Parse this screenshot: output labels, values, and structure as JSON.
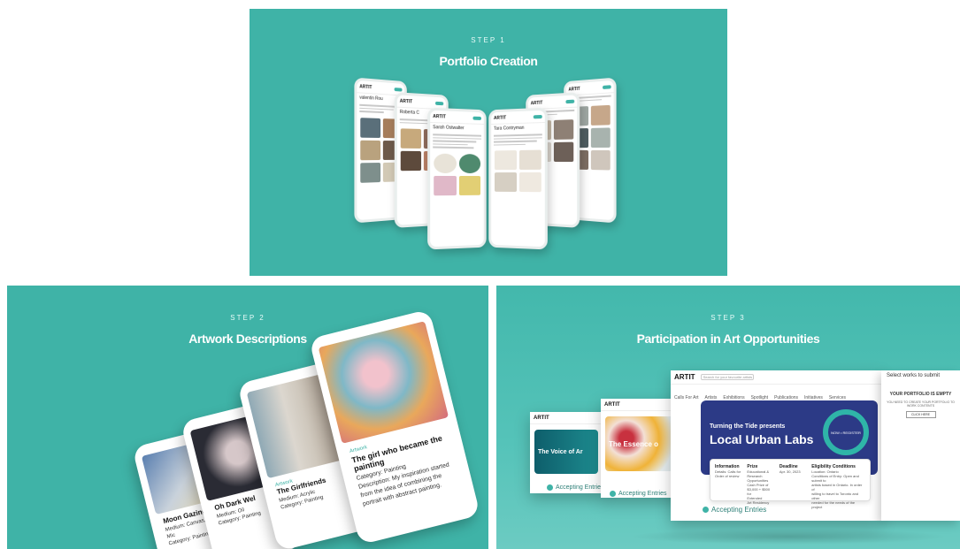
{
  "colors": {
    "accent": "#3fb3a7",
    "banner": "#2c3a86",
    "white": "#ffffff"
  },
  "step1": {
    "label": "STEP 1",
    "title": "Portfolio Creation",
    "phones": [
      {
        "brand": "ARTIT",
        "name": "valentin Rou"
      },
      {
        "brand": "ARTIT",
        "name": "Roberta C"
      },
      {
        "brand": "ARTIT",
        "name": "Sarah Ostwalter"
      },
      {
        "brand": "ARTIT",
        "name": "Tara Contryman"
      },
      {
        "brand": "ARTIT",
        "name": ""
      },
      {
        "brand": "ARTIT",
        "name": ""
      }
    ]
  },
  "step2": {
    "label": "STEP 2",
    "title": "Artwork Descriptions",
    "cards": [
      {
        "title": "Moon Gazing",
        "year": "2021",
        "medium": "Medium: Canvas, ink, Mic",
        "category": "Category: Painting"
      },
      {
        "title": "Oh Dark Wel",
        "year": "2022",
        "medium": "Medium: Oil",
        "category": "Category: Painting"
      },
      {
        "title": "The Girlfriends",
        "year": "2022",
        "medium": "Medium: Acrylic",
        "category": "Category: Painting"
      },
      {
        "title": "The girl who became the painting",
        "year": "",
        "medium": "Category: Painting",
        "category": "Description: My inspiration started from the idea of combining the portrait with abstract painting."
      }
    ]
  },
  "step3": {
    "label": "STEP 3",
    "title": "Participation in Art Opportunities",
    "win_left": {
      "brand": "ARTIT",
      "banner": "The Voice of Ar",
      "status": "Accepting Entries"
    },
    "win_mid": {
      "brand": "ARTIT",
      "banner": "The Essence o",
      "status": "Accepting Entries"
    },
    "win_main": {
      "brand": "ARTIT",
      "search_placeholder": "Search for your favourite artists",
      "nav": [
        "Calls For Art",
        "Artists",
        "Exhibitions",
        "Spotlight",
        "Publications",
        "Initiatives",
        "Services"
      ],
      "presenter": "Turning the Tide presents",
      "headline": "Local Urban Labs",
      "badge": "NOW • REGISTER",
      "info": {
        "h": "Information",
        "t": "Details: Calls for\nOrder of review"
      },
      "prize": {
        "h": "Prize",
        "t": "Educational &\nResearch\nOpportunities\nCash Prize of\n$3,000 + $500 for\nExtended\nArt Residency"
      },
      "deadline": {
        "h": "Deadline",
        "t": "Apr. 30, 2023"
      },
      "eligibility": {
        "h": "Eligibility Conditions",
        "t": "Location: Ontario\nConditions of Entry: Open and submit to\nartists based in Ontario. In order of\nwilling to travel to Toronto and other\nneeded for the needs of the project"
      },
      "status": "Accepting Entries"
    },
    "side": {
      "heading": "Select works to submit",
      "empty_title": "YOUR PORTFOLIO IS EMPTY",
      "empty_text": "YOU NEED TO CREATE YOUR PORTFOLIO TO WORK CONTENTS",
      "button": "CLICK HERE"
    }
  }
}
